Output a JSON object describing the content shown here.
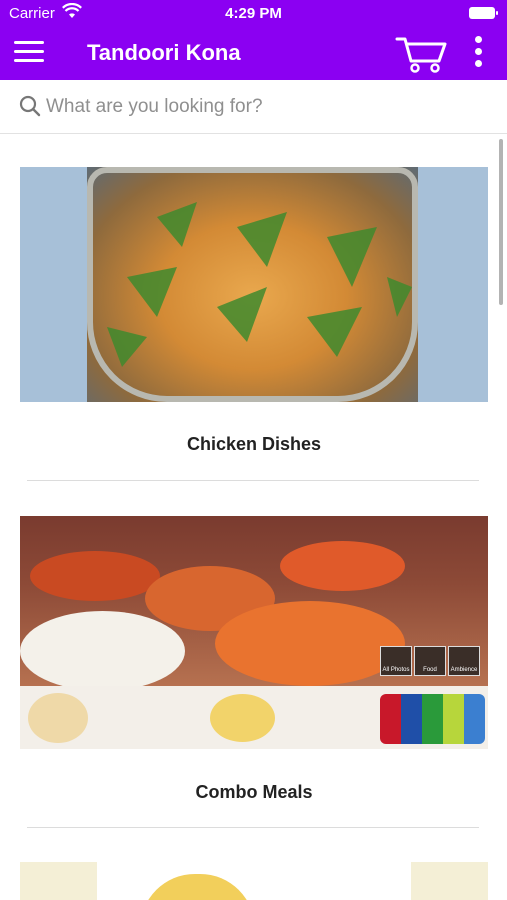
{
  "status_bar": {
    "carrier": "Carrier",
    "time": "4:29 PM"
  },
  "app_bar": {
    "title": "Tandoori Kona",
    "menu_icon": "hamburger-menu-icon",
    "cart_icon": "shopping-cart-icon",
    "more_icon": "more-vertical-icon"
  },
  "search": {
    "placeholder": "What are you looking for?",
    "value": ""
  },
  "categories": [
    {
      "label": "Chicken Dishes"
    },
    {
      "label": "Combo Meals",
      "thumbnails": [
        "All Photos",
        "Food",
        "Ambience"
      ]
    },
    {
      "label": ""
    }
  ],
  "colors": {
    "brand": "#8b00f2",
    "background": "#ffffff",
    "text": "#222222",
    "placeholder": "#8f8f8f"
  }
}
